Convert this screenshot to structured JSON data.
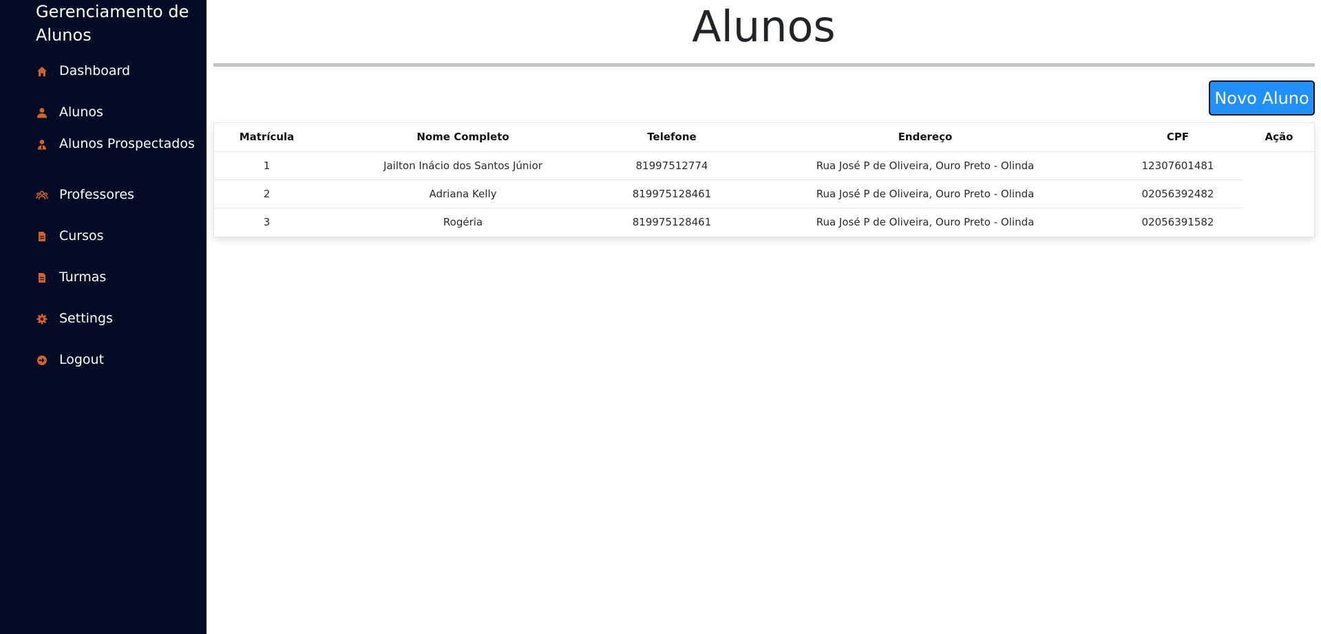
{
  "sidebar": {
    "brand": "Gerenciamento de Alunos",
    "icon_color": "#d2622a",
    "items": [
      {
        "label": "Dashboard",
        "icon": "home-icon"
      },
      {
        "label": "Alunos",
        "icon": "user-icon"
      },
      {
        "label": "Alunos Prospectados",
        "icon": "user-tie-icon"
      },
      {
        "label": "Professores",
        "icon": "users-icon"
      },
      {
        "label": "Cursos",
        "icon": "file-icon"
      },
      {
        "label": "Turmas",
        "icon": "file-icon"
      },
      {
        "label": "Settings",
        "icon": "gear-icon"
      },
      {
        "label": "Logout",
        "icon": "logout-icon"
      }
    ]
  },
  "main": {
    "title": "Alunos",
    "new_button_label": "Novo Aluno",
    "button_color": "#1e90ff",
    "table": {
      "headers": [
        "Matrícula",
        "Nome Completo",
        "Telefone",
        "Endereço",
        "CPF",
        "Ação"
      ],
      "rows": [
        {
          "matricula": "1",
          "nome": "Jailton Inácio dos Santos Júnior",
          "telefone": "81997512774",
          "endereco": "Rua José P de Oliveira, Ouro Preto - Olinda",
          "cpf": "12307601481"
        },
        {
          "matricula": "2",
          "nome": "Adriana Kelly",
          "telefone": "819975128461",
          "endereco": "Rua José P de Oliveira, Ouro Preto - Olinda",
          "cpf": "02056392482"
        },
        {
          "matricula": "3",
          "nome": "Rogéria",
          "telefone": "819975128461",
          "endereco": "Rua José P de Oliveira, Ouro Preto - Olinda",
          "cpf": "02056391582"
        }
      ]
    }
  }
}
